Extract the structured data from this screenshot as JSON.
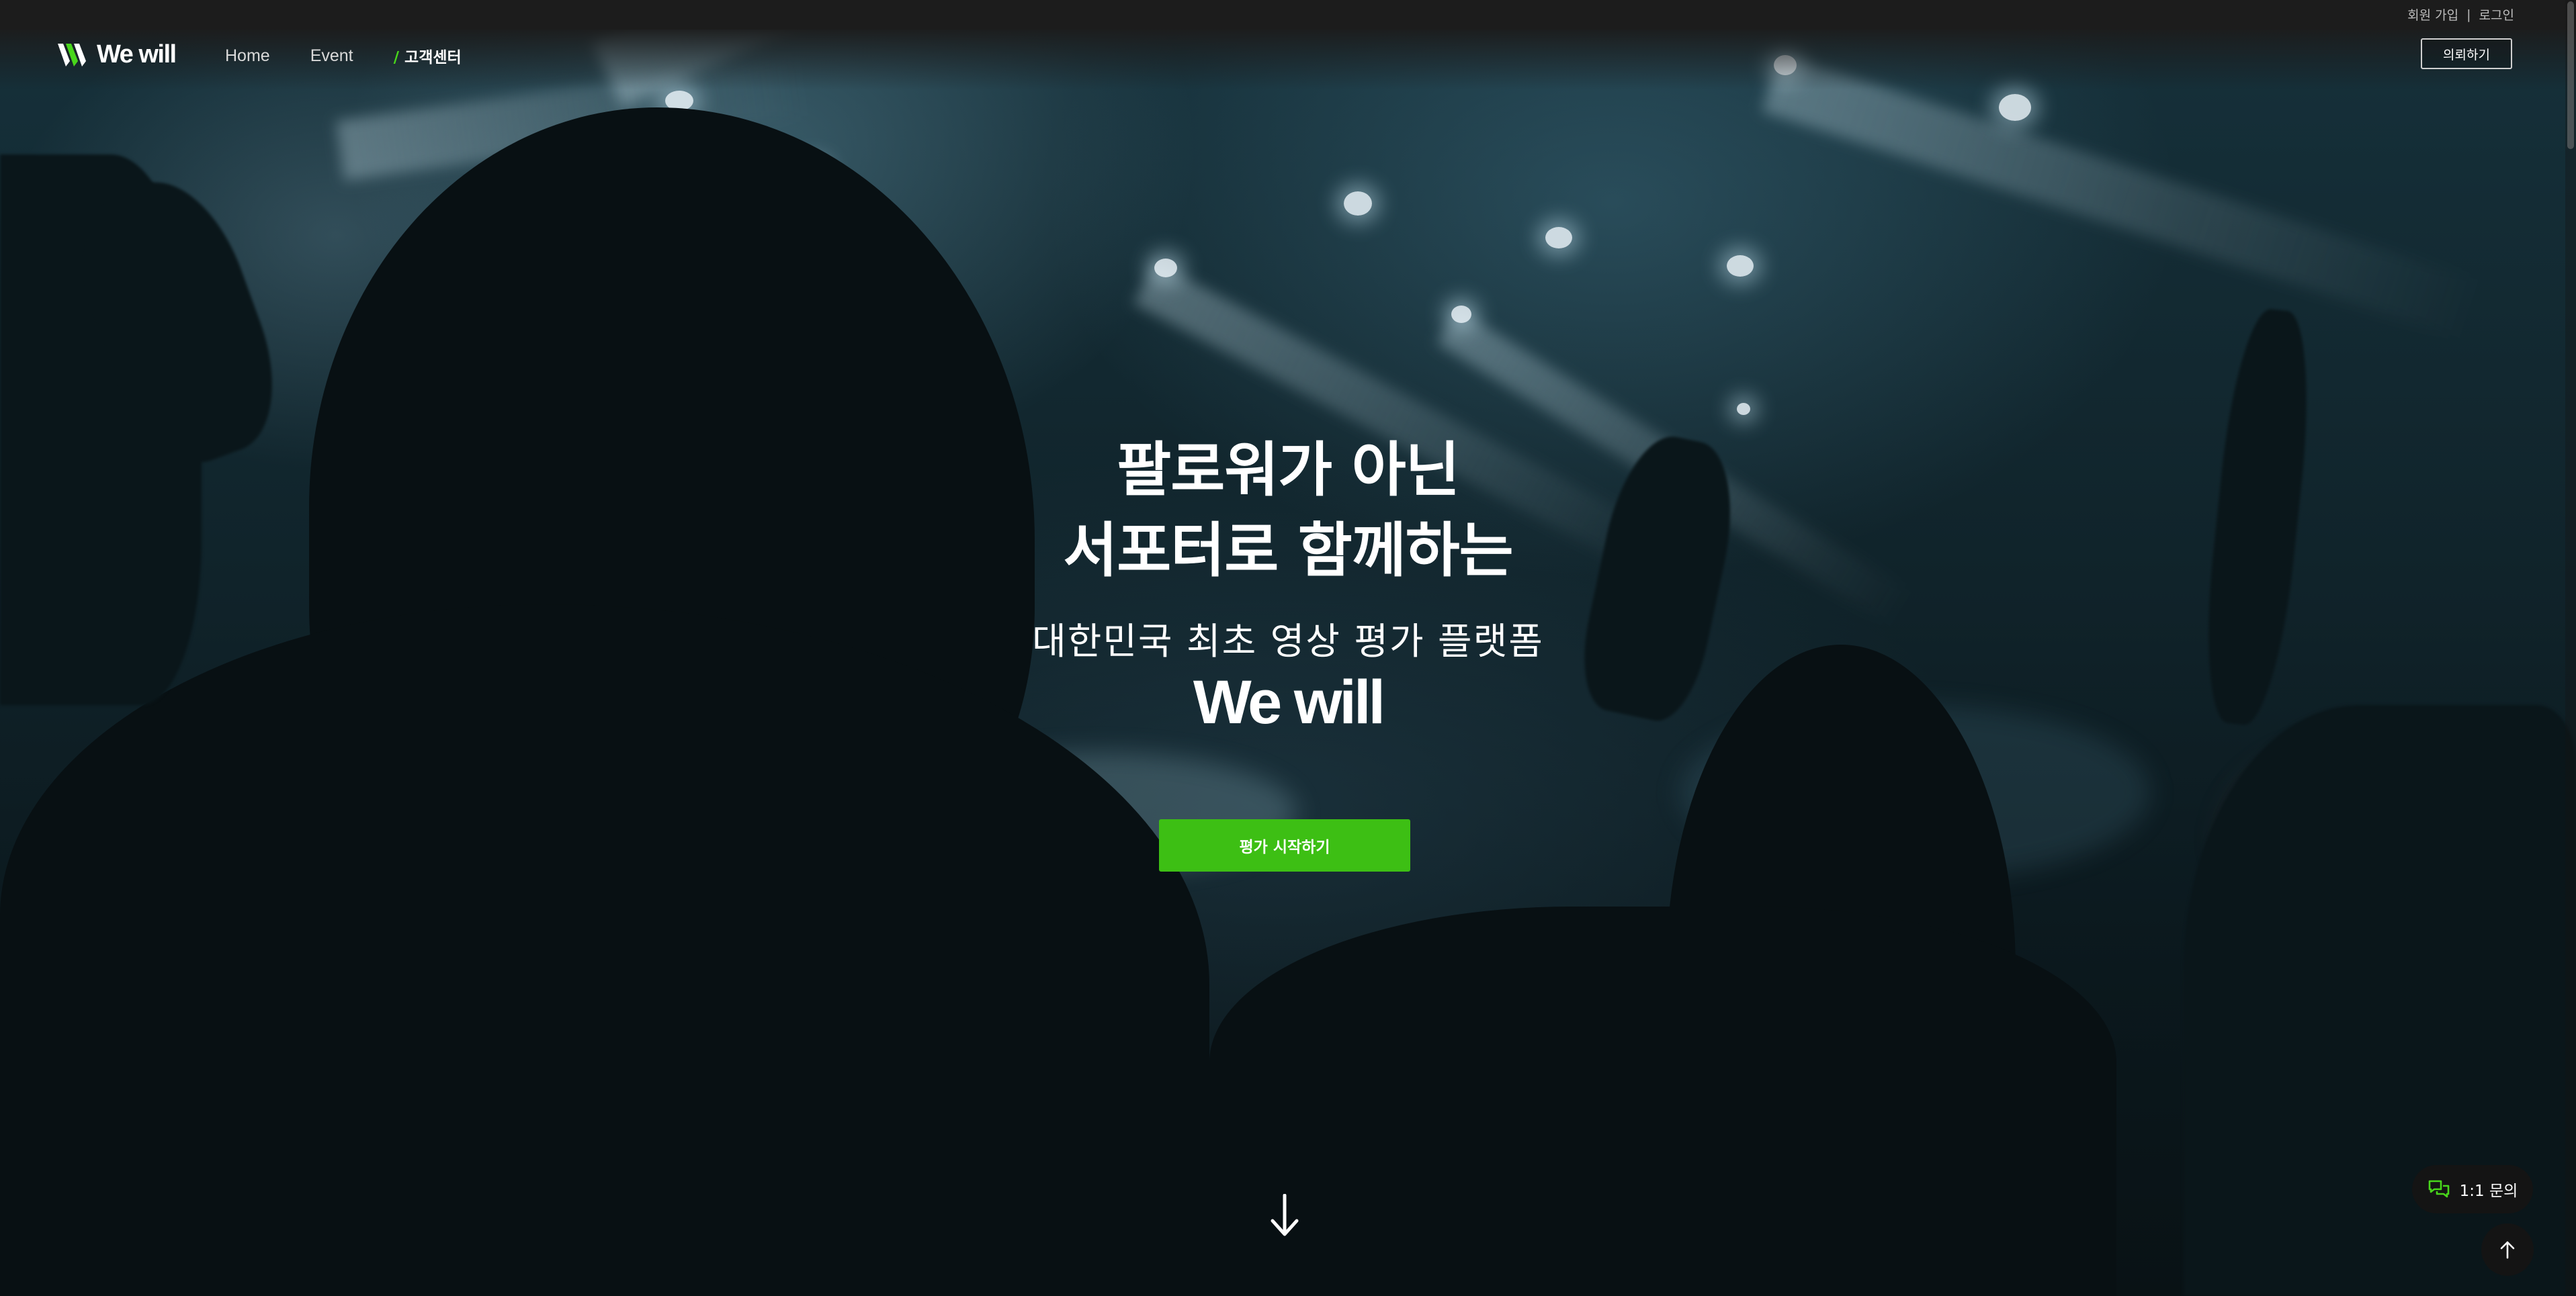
{
  "utility": {
    "signup": "회원 가입",
    "separator": "|",
    "login": "로그인"
  },
  "brand": {
    "name": "We will"
  },
  "nav": {
    "items": [
      {
        "label": "Home"
      },
      {
        "label": "Event"
      }
    ],
    "active": {
      "slash": "/",
      "label": "고객센터"
    }
  },
  "header": {
    "inquiry_label": "의뢰하기"
  },
  "hero": {
    "line1": "팔로워가 아닌",
    "line2": "서포터로 함께하는",
    "subtitle": "대한민국 최초 영상 평가 플랫폼",
    "brand": "We will",
    "cta_label": "평가 시작하기"
  },
  "floating": {
    "chat_label": "1:1 문의"
  },
  "colors": {
    "accent": "#3dbf14",
    "accent_bright": "#48d61b",
    "topbar": "#1c1c1c",
    "floating_bg": "#141414"
  },
  "icons": {
    "logo": "wewill-logo-icon",
    "scroll_down": "arrow-down-icon",
    "chat": "chat-bubbles-icon",
    "to_top": "arrow-up-icon"
  }
}
